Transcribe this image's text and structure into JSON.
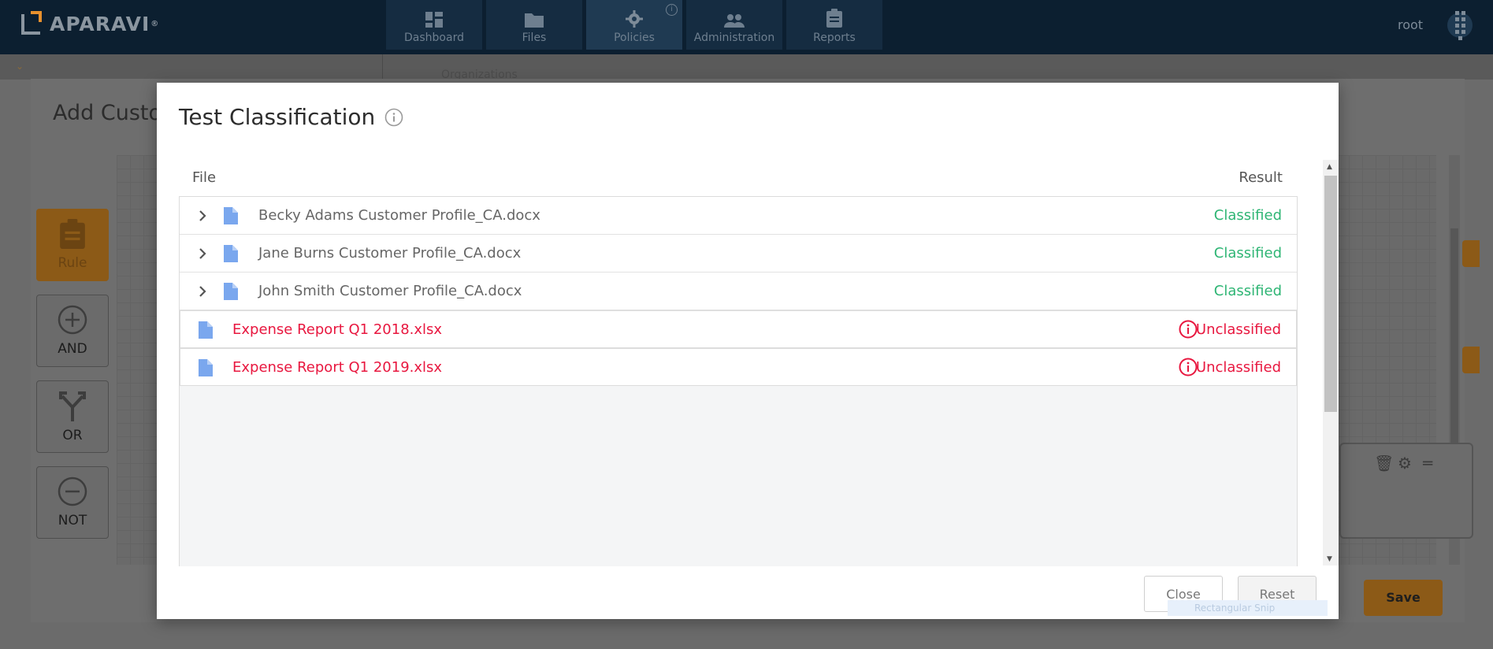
{
  "app": {
    "logo": "APARAVI",
    "user": "root"
  },
  "nav": [
    {
      "label": "Dashboard",
      "icon": "dashboard-icon"
    },
    {
      "label": "Files",
      "icon": "folder-icon"
    },
    {
      "label": "Policies",
      "icon": "gear-icon",
      "active": true
    },
    {
      "label": "Administration",
      "icon": "people-icon"
    },
    {
      "label": "Reports",
      "icon": "clipboard-icon"
    }
  ],
  "background": {
    "crumb": "Organizations",
    "dialog_title": "Add Custo",
    "tools": [
      {
        "label": "Rule",
        "icon": "clipboard-icon"
      },
      {
        "label": "AND",
        "icon": "plus-circle-icon"
      },
      {
        "label": "OR",
        "icon": "fork-icon"
      },
      {
        "label": "NOT",
        "icon": "minus-circle-icon"
      }
    ],
    "save_label": "Save",
    "ghost_text": "Rectangular Snip"
  },
  "modal": {
    "title": "Test Classification",
    "columns": {
      "file": "File",
      "result": "Result"
    },
    "rows": [
      {
        "name": "Becky Adams Customer Profile_CA.docx",
        "result": "Classified",
        "status": "ok"
      },
      {
        "name": "Jane Burns Customer Profile_CA.docx",
        "result": "Classified",
        "status": "ok"
      },
      {
        "name": "John Smith Customer Profile_CA.docx",
        "result": "Classified",
        "status": "ok"
      },
      {
        "name": "Expense Report Q1 2018.xlsx",
        "result": "Unclassified",
        "status": "error"
      },
      {
        "name": "Expense Report Q1 2019.xlsx",
        "result": "Unclassified",
        "status": "error"
      }
    ],
    "buttons": {
      "close": "Close",
      "reset": "Reset"
    }
  },
  "colors": {
    "classified": "#2eb574",
    "unclassified": "#e8173f",
    "accent": "#e8912d",
    "topbar": "#0c1f30"
  }
}
